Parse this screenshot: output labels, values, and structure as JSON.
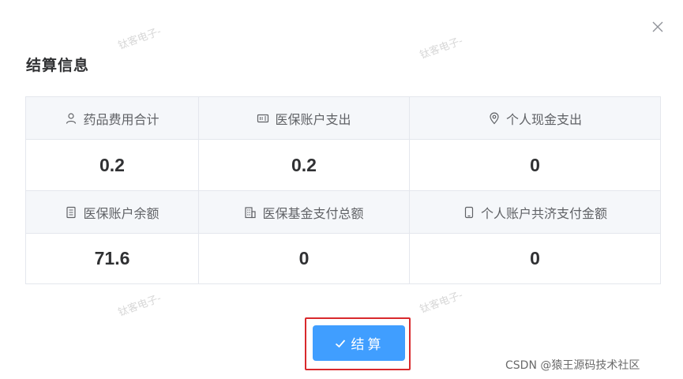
{
  "dialog": {
    "title": "结算信息",
    "close_label": "×"
  },
  "info_grid": {
    "row1": [
      {
        "label": "药品费用合计",
        "icon": "user-icon",
        "value": "0.2"
      },
      {
        "label": "医保账户支出",
        "icon": "card-icon",
        "value": "0.2"
      },
      {
        "label": "个人现金支出",
        "icon": "location-icon",
        "value": "0"
      }
    ],
    "row2": [
      {
        "label": "医保账户余额",
        "icon": "document-icon",
        "value": "71.6"
      },
      {
        "label": "医保基金支付总额",
        "icon": "building-icon",
        "value": "0"
      },
      {
        "label": "个人账户共济支付金额",
        "icon": "mobile-icon",
        "value": "0"
      }
    ]
  },
  "settle_button": {
    "label": "结算",
    "icon": "check-icon"
  },
  "watermark": {
    "text": "钛客电子-"
  },
  "footer": {
    "credit": "CSDN @猿王源码技术社区"
  },
  "colors": {
    "primary": "#409eff",
    "highlight_border": "#d9292c",
    "label_bg": "#f5f7fa",
    "border": "#e4e7ed"
  }
}
